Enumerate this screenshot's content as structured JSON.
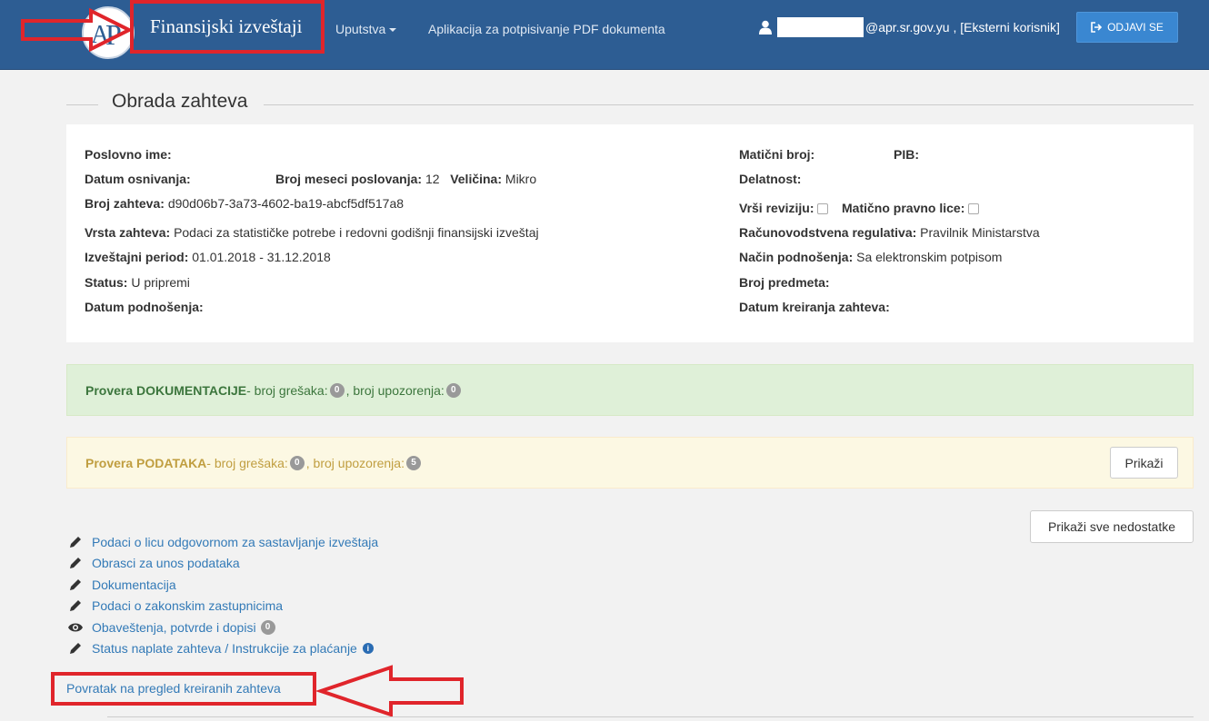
{
  "navbar": {
    "brand": "Finansijski izveštaji",
    "menu_uputstva": "Uputstva",
    "menu_app": "Aplikacija za potpisivanje PDF dokumenta",
    "user_text": "@apr.sr.gov.yu , [Eksterni korisnik]",
    "logout_label": "ODJAVI SE"
  },
  "section": {
    "title": "Obrada zahteva"
  },
  "info": {
    "poslovno_ime_label": "Poslovno ime:",
    "datum_osnivanja_label": "Datum osnivanja:",
    "broj_meseci_label": "Broj meseci poslovanja:",
    "broj_meseci_value": "12",
    "velicina_label": "Veličina:",
    "velicina_value": "Mikro",
    "broj_zahteva_label": "Broj zahteva:",
    "broj_zahteva_value": "d90d06b7-3a73-4602-ba19-abcf5df517a8",
    "vrsta_zahteva_label": "Vrsta zahteva:",
    "vrsta_zahteva_value": "Podaci za statističke potrebe i redovni godišnji finansijski izveštaj",
    "izvestajni_period_label": "Izveštajni period:",
    "izvestajni_period_value": "01.01.2018 - 31.12.2018",
    "status_label": "Status:",
    "status_value": "U pripremi",
    "datum_podnosenja_label": "Datum podnošenja:",
    "maticni_broj_label": "Matični broj:",
    "pib_label": "PIB:",
    "delatnost_label": "Delatnost:",
    "vrsi_reviziju_label": "Vrši reviziju:",
    "maticno_pravno_lice_label": "Matično pravno lice:",
    "racunovodstvena_label": "Računovodstvena regulativa:",
    "racunovodstvena_value": "Pravilnik Ministarstva",
    "nacin_label": "Način podnošenja:",
    "nacin_value": "Sa elektronskim potpisom",
    "broj_predmeta_label": "Broj predmeta:",
    "datum_kreiranja_label": "Datum kreiranja zahteva:"
  },
  "alerts": {
    "doc_title": "Provera DOKUMENTACIJE",
    "doc_err_text": " - broj grešaka: ",
    "doc_err_count": "0",
    "doc_warn_text": ", broj upozorenja: ",
    "doc_warn_count": "0",
    "data_title": "Provera PODATAKA",
    "data_err_text": " - broj grešaka: ",
    "data_err_count": "0",
    "data_warn_text": ", broj upozorenja: ",
    "data_warn_count": "5",
    "show_label": "Prikaži",
    "show_all_label": "Prikaži sve nedostatke"
  },
  "links": [
    {
      "label": "Podaci o licu odgovornom za sastavljanje izveštaja"
    },
    {
      "label": "Obrasci za unos podataka"
    },
    {
      "label": "Dokumentacija"
    },
    {
      "label": "Podaci o zakonskim zastupnicima"
    },
    {
      "label": "Obaveštenja, potvrde i dopisi",
      "badge": "0"
    },
    {
      "label": "Status naplate zahteva / Instrukcije za plaćanje"
    }
  ],
  "back_link": "Povratak na pregled kreiranih zahteva",
  "colors": {
    "navbar": "#2d5d93",
    "logout_button": "#3a87d1",
    "annotation_red": "#e0252b",
    "link": "#337ab7"
  }
}
